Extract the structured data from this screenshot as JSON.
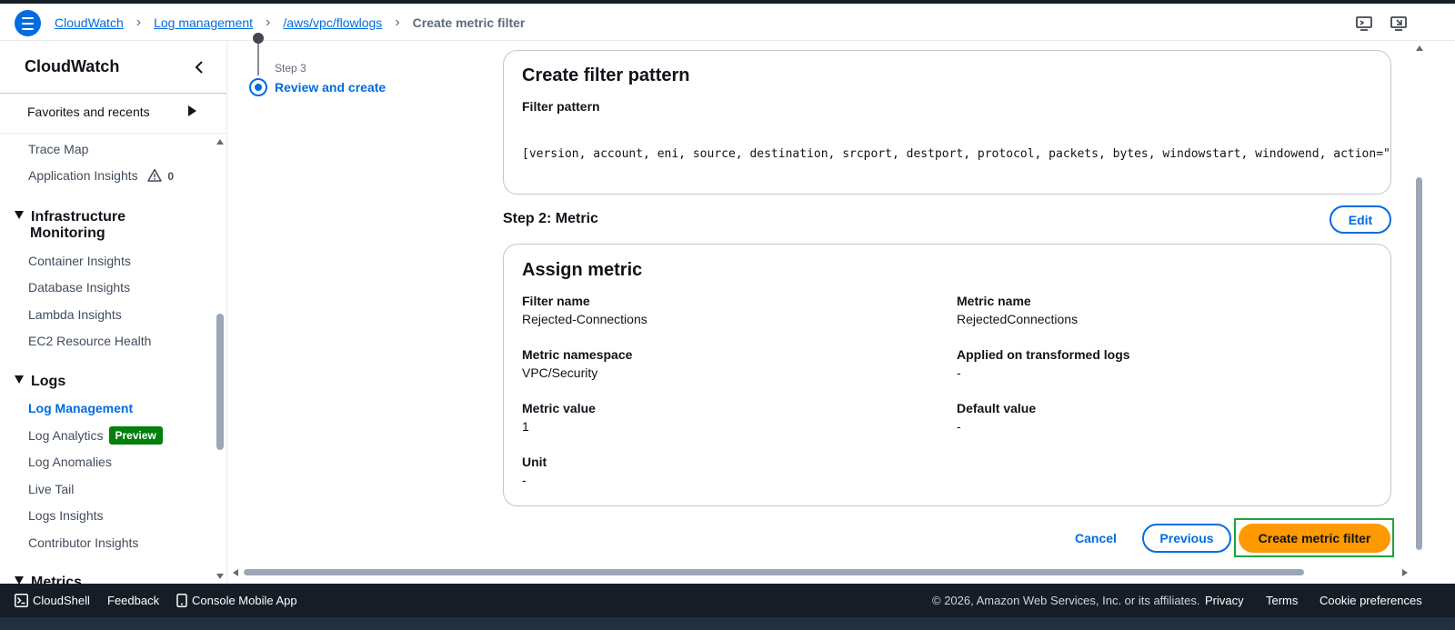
{
  "breadcrumbs": [
    {
      "label": "CloudWatch",
      "type": "link"
    },
    {
      "label": "Log management",
      "type": "link"
    },
    {
      "label": "/aws/vpc/flowlogs",
      "type": "link"
    },
    {
      "label": "Create metric filter",
      "type": "current"
    }
  ],
  "icons": {
    "menu": "hamburger-menu-icon",
    "top_right_1": "notifications-monitor-icon",
    "top_right_2": "display-settings-icon",
    "sidebar_collapse": "chevron-left-icon",
    "warning": "warning-triangle-icon",
    "cloudshell": "terminal-icon",
    "mobile": "mobile-phone-icon"
  },
  "sidebar": {
    "title": "CloudWatch",
    "favorites_label": "Favorites and recents",
    "items_top": [
      {
        "label": "Trace Map"
      },
      {
        "label": "Application Insights",
        "count": "0"
      }
    ],
    "infra_section": {
      "line1": "Infrastructure",
      "line2": "Monitoring"
    },
    "infra_items": [
      {
        "label": "Container Insights"
      },
      {
        "label": "Database Insights"
      },
      {
        "label": "Lambda Insights"
      },
      {
        "label": "EC2 Resource Health"
      }
    ],
    "logs_section": "Logs",
    "logs_items": [
      {
        "label": "Log Management",
        "active": true
      },
      {
        "label": "Log Analytics",
        "badge": "Preview"
      },
      {
        "label": "Log Anomalies"
      },
      {
        "label": "Live Tail"
      },
      {
        "label": "Logs Insights"
      },
      {
        "label": "Contributor Insights"
      }
    ],
    "metrics_section": "Metrics"
  },
  "wizard": {
    "step3_label": "Step 3",
    "step3_title": "Review and create"
  },
  "filter_card": {
    "title": "Create filter pattern",
    "pattern_label": "Filter pattern",
    "pattern_value": "[version, account, eni, source, destination, srcport, destport, protocol, packets, bytes, windowstart, windowend, action=\"REJECT\","
  },
  "step2": {
    "heading": "Step 2: Metric",
    "edit_label": "Edit"
  },
  "metric_card": {
    "title": "Assign metric",
    "fields": {
      "filter_name": {
        "label": "Filter name",
        "value": "Rejected-Connections"
      },
      "metric_name": {
        "label": "Metric name",
        "value": "RejectedConnections"
      },
      "metric_namespace": {
        "label": "Metric namespace",
        "value": "VPC/Security"
      },
      "applied_on_transformed": {
        "label": "Applied on transformed logs",
        "value": "-"
      },
      "metric_value": {
        "label": "Metric value",
        "value": "1"
      },
      "default_value": {
        "label": "Default value",
        "value": "-"
      },
      "unit": {
        "label": "Unit",
        "value": "-"
      }
    }
  },
  "actions": {
    "cancel": "Cancel",
    "previous": "Previous",
    "create": "Create metric filter"
  },
  "footer": {
    "cloudshell": "CloudShell",
    "feedback": "Feedback",
    "mobile_app": "Console Mobile App",
    "copyright": "© 2026, Amazon Web Services, Inc. or its affiliates.",
    "privacy": "Privacy",
    "terms": "Terms",
    "cookie": "Cookie preferences"
  },
  "colors": {
    "accent": "#006ce0",
    "primary_button": "#ff9900",
    "preview_badge": "#037f0c",
    "footer_bg": "#161d26",
    "highlight_outline": "#1fa23a"
  }
}
